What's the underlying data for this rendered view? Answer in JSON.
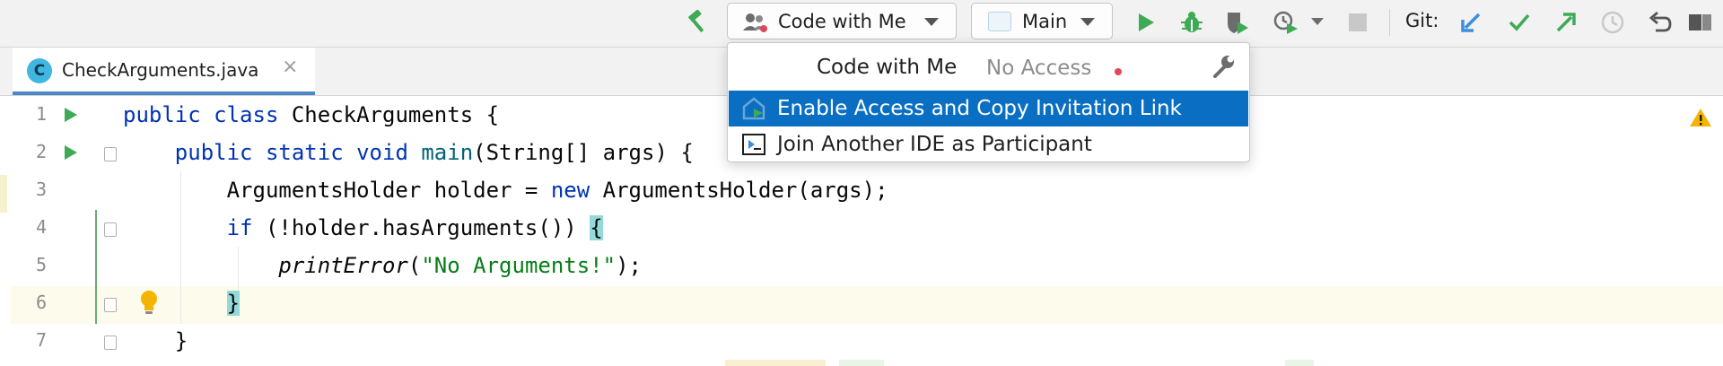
{
  "toolbar": {
    "code_with_me_label": "Code with Me",
    "run_config_label": "Main",
    "git_label": "Git:",
    "icons": [
      "build-hammer-icon",
      "users-icon",
      "run-icon",
      "debug-icon",
      "coverage-icon",
      "profiler-icon",
      "stop-icon",
      "git-update-icon",
      "git-commit-icon",
      "git-push-icon",
      "history-icon",
      "rollback-icon"
    ],
    "colors": {
      "run": "#3eaa55",
      "git_blue": "#3b8ee0",
      "git_green": "#3eaa55"
    }
  },
  "tabs": [
    {
      "title": "CheckArguments.java",
      "icon_letter": "C",
      "active": true
    }
  ],
  "editor": {
    "line_numbers": [
      "1",
      "2",
      "3",
      "4",
      "5",
      "6",
      "7"
    ],
    "lines": [
      {
        "kw1": "public",
        "kw2": "class",
        "name": "CheckArguments",
        "brace": "{"
      },
      {
        "kw1": "public",
        "kw2": "static",
        "kw3": "void",
        "fn": "main",
        "args": "(String[] args) {"
      },
      {
        "decl": "ArgumentsHolder holder = ",
        "kw": "new",
        "rest": " ArgumentsHolder(args);"
      },
      {
        "kw": "if",
        "cond": " (!holder.hasArguments()) ",
        "brace": "{"
      },
      {
        "method": "printError",
        "open": "(",
        "str": "\"No Arguments!\"",
        "close": ");"
      },
      {
        "brace": "}"
      },
      {
        "brace": "}"
      }
    ]
  },
  "popup": {
    "title": "Code with Me",
    "status": "No Access",
    "items": [
      {
        "label": "Enable Access and Copy Invitation Link",
        "selected": true
      },
      {
        "label": "Join Another IDE as Participant",
        "selected": false
      }
    ]
  }
}
